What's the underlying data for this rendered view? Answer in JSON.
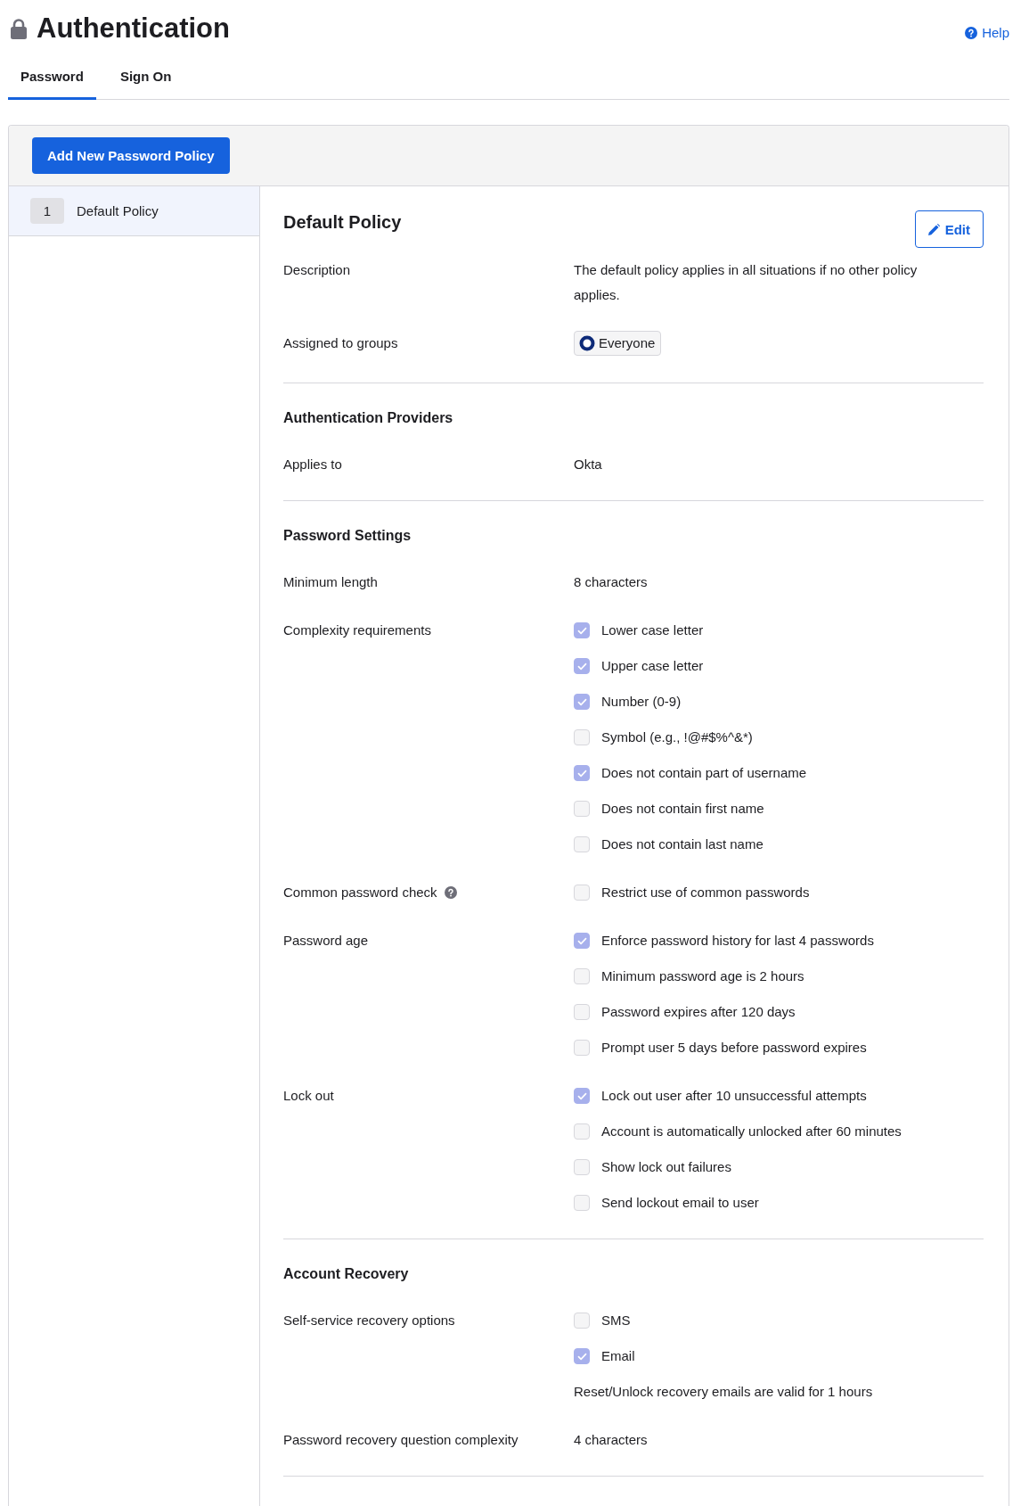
{
  "header": {
    "title": "Authentication",
    "help_link": "Help"
  },
  "tabs": [
    {
      "label": "Password",
      "selected": true
    },
    {
      "label": "Sign On",
      "selected": false
    }
  ],
  "toolbar": {
    "add_button": "Add New Password Policy"
  },
  "policy_list": [
    {
      "rank": "1",
      "name": "Default Policy",
      "selected": true
    }
  ],
  "policy": {
    "title": "Default Policy",
    "edit_button": "Edit",
    "sections": [
      {
        "rows": [
          {
            "kind": "text",
            "label": "Description",
            "info": false,
            "value": "The default policy applies in all situations if no other policy applies."
          },
          {
            "kind": "groups",
            "label": "Assigned to groups",
            "info": false,
            "groups": [
              "Everyone"
            ]
          }
        ]
      },
      {
        "heading": "Authentication Providers",
        "rows": [
          {
            "kind": "text",
            "label": "Applies to",
            "info": false,
            "value": "Okta"
          }
        ]
      },
      {
        "heading": "Password Settings",
        "rows": [
          {
            "kind": "text",
            "label": "Minimum length",
            "info": false,
            "value": "8 characters"
          },
          {
            "kind": "checks",
            "label": "Complexity requirements",
            "info": false,
            "options": [
              {
                "label": "Lower case letter",
                "checked": true
              },
              {
                "label": "Upper case letter",
                "checked": true
              },
              {
                "label": "Number (0-9)",
                "checked": true
              },
              {
                "label": "Symbol (e.g., !@#$%^&*)",
                "checked": false
              },
              {
                "label": "Does not contain part of username",
                "checked": true
              },
              {
                "label": "Does not contain first name",
                "checked": false
              },
              {
                "label": "Does not contain last name",
                "checked": false
              }
            ]
          },
          {
            "kind": "checks",
            "label": "Common password check",
            "info": true,
            "options": [
              {
                "label": "Restrict use of common passwords",
                "checked": false
              }
            ]
          },
          {
            "kind": "checks",
            "label": "Password age",
            "info": false,
            "options": [
              {
                "label": "Enforce password history for last 4 passwords",
                "checked": true
              },
              {
                "label": "Minimum password age is 2 hours",
                "checked": false
              },
              {
                "label": "Password expires after 120 days",
                "checked": false
              },
              {
                "label": "Prompt user 5 days before password expires",
                "checked": false
              }
            ]
          },
          {
            "kind": "checks",
            "label": "Lock out",
            "info": false,
            "options": [
              {
                "label": "Lock out user after 10 unsuccessful attempts",
                "checked": true
              },
              {
                "label": "Account is automatically unlocked after 60 minutes",
                "checked": false
              },
              {
                "label": "Show lock out failures",
                "checked": false
              },
              {
                "label": "Send lockout email to user",
                "checked": false
              }
            ]
          }
        ]
      },
      {
        "heading": "Account Recovery",
        "rows": [
          {
            "kind": "checks",
            "label": "Self-service recovery options",
            "info": false,
            "options": [
              {
                "label": "SMS",
                "checked": false
              },
              {
                "label": "Email",
                "checked": true
              }
            ],
            "note": "Reset/Unlock recovery emails are valid for 1 hours"
          },
          {
            "kind": "text",
            "label": "Password recovery question complexity",
            "info": false,
            "value": "4 characters"
          }
        ]
      }
    ]
  }
}
